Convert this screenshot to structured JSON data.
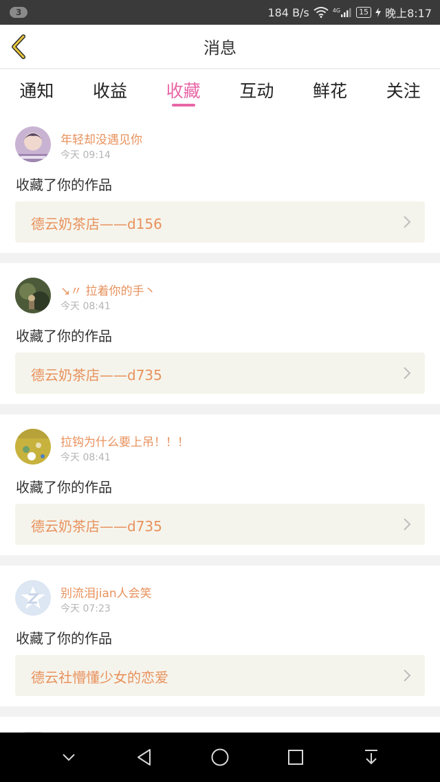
{
  "status_bar": {
    "notification_count": "3",
    "network_speed": "184 B/s",
    "network_type": "4G",
    "battery_level": "15",
    "time": "晚上8:17"
  },
  "header": {
    "title": "消息"
  },
  "tabs": [
    {
      "label": "通知",
      "active": false
    },
    {
      "label": "收益",
      "active": false
    },
    {
      "label": "收藏",
      "active": true
    },
    {
      "label": "互动",
      "active": false
    },
    {
      "label": "鲜花",
      "active": false
    },
    {
      "label": "关注",
      "active": false
    }
  ],
  "colors": {
    "accent": "#e866a6",
    "username": "#e8915c",
    "link_bg": "#f5f4ec"
  },
  "messages": [
    {
      "username": "年轻却没遇见你",
      "time": "今天 09:14",
      "action": "收藏了你的作品",
      "work_title": "德云奶茶店——d156",
      "avatar": "photo-avatar-purple"
    },
    {
      "username": "↘〃 拉着你的手丶",
      "time": "今天 08:41",
      "action": "收藏了你的作品",
      "work_title": "德云奶茶店——d735",
      "avatar": "photo-avatar-green"
    },
    {
      "username": "拉钩为什么要上吊！！！",
      "time": "今天 08:41",
      "action": "收藏了你的作品",
      "work_title": "德云奶茶店——d735",
      "avatar": "photo-avatar-yellow"
    },
    {
      "username": "别流泪jian人会笑",
      "time": "今天 07:23",
      "action": "收藏了你的作品",
      "work_title": "德云社懵懂少女的恋爱",
      "avatar": "default-avatar-icon"
    }
  ],
  "nav_bar": {
    "buttons": [
      "collapse-icon",
      "back-triangle-icon",
      "home-circle-icon",
      "recents-square-icon",
      "notification-pull-icon"
    ]
  }
}
